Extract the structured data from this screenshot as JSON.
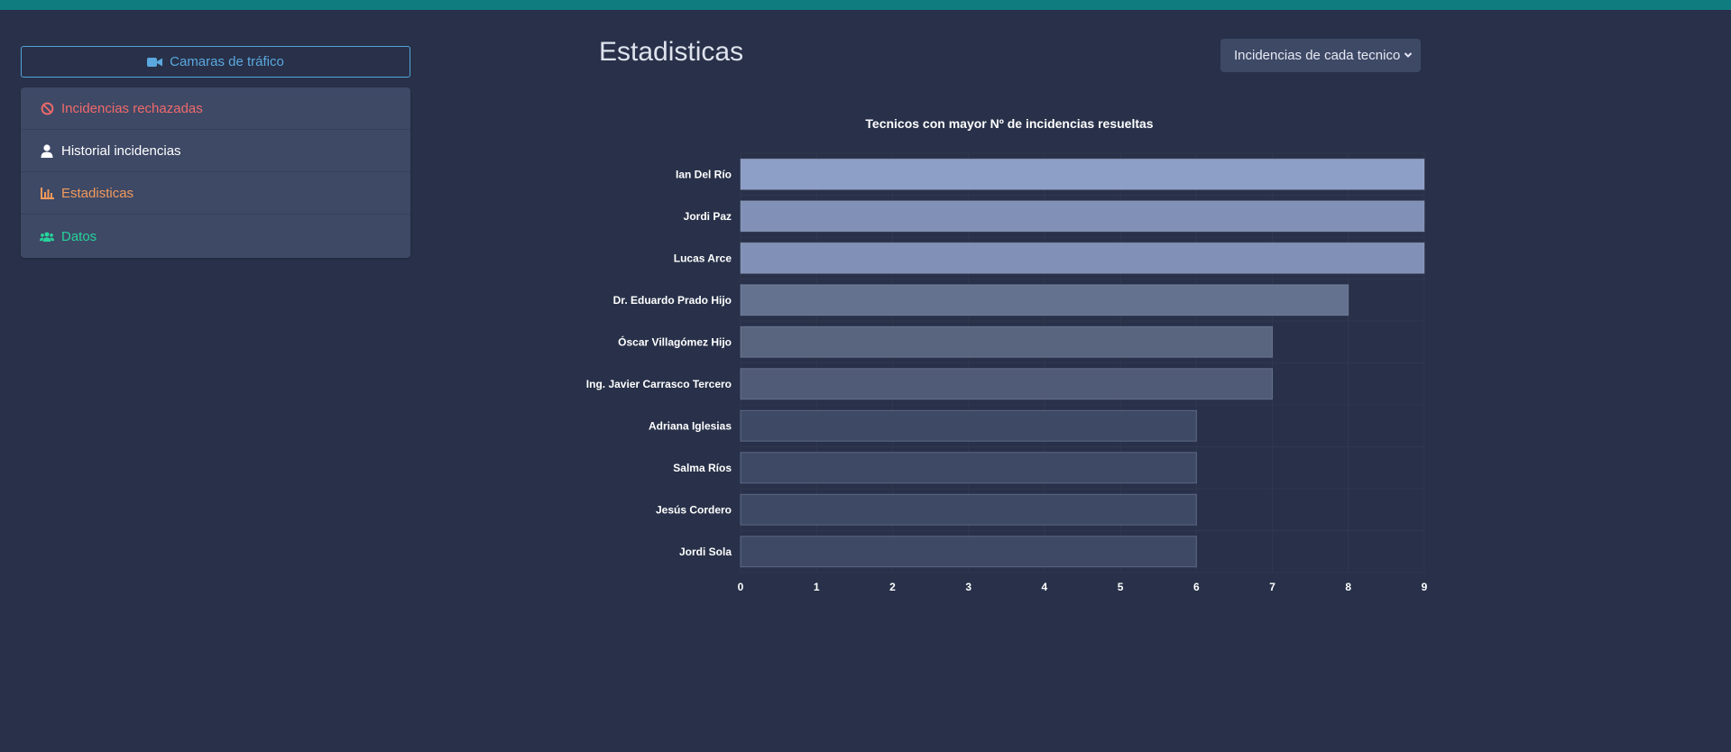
{
  "sidebar": {
    "camera_button": {
      "label": "Camaras de tráfico",
      "icon": "video-camera-icon",
      "color": "#5ba8e0"
    },
    "items": [
      {
        "label": "Incidencias rechazadas",
        "icon": "ban-icon",
        "color": "#f06a6a"
      },
      {
        "label": "Historial incidencias",
        "icon": "user-icon",
        "color": "#ffffff"
      },
      {
        "label": "Estadisticas",
        "icon": "chart-bar-icon",
        "color": "#f39a5b"
      },
      {
        "label": "Datos",
        "icon": "users-icon",
        "color": "#27d39a"
      }
    ]
  },
  "main": {
    "title": "Estadisticas",
    "select": {
      "value": "Incidencias de cada tecnico",
      "icon": "chevron-down-icon"
    }
  },
  "chart_data": {
    "type": "bar",
    "orientation": "horizontal",
    "title": "Tecnicos con mayor Nº de incidencias resueltas",
    "categories": [
      "Ian Del Río",
      "Jordi Paz",
      "Lucas Arce",
      "Dr. Eduardo Prado Hijo",
      "Óscar Villagómez Hijo",
      "Ing. Javier Carrasco Tercero",
      "Adriana Iglesias",
      "Salma Ríos",
      "Jesús Cordero",
      "Jordi Sola"
    ],
    "values": [
      9,
      9,
      9,
      8,
      7,
      7,
      6,
      6,
      6,
      6
    ],
    "xlim": [
      0,
      9
    ],
    "xticks": [
      "0",
      "1",
      "2",
      "3",
      "4",
      "5",
      "6",
      "7",
      "8",
      "9"
    ],
    "grid": true,
    "legend": "none",
    "bar_colors": [
      "#8e9fc7",
      "#8090b6",
      "#8090b6",
      "#64718f",
      "#59657f",
      "#505b78",
      "#3e4966",
      "#3e4966",
      "#3e4966",
      "#3e4966"
    ],
    "grid_color": "#2f384f"
  }
}
